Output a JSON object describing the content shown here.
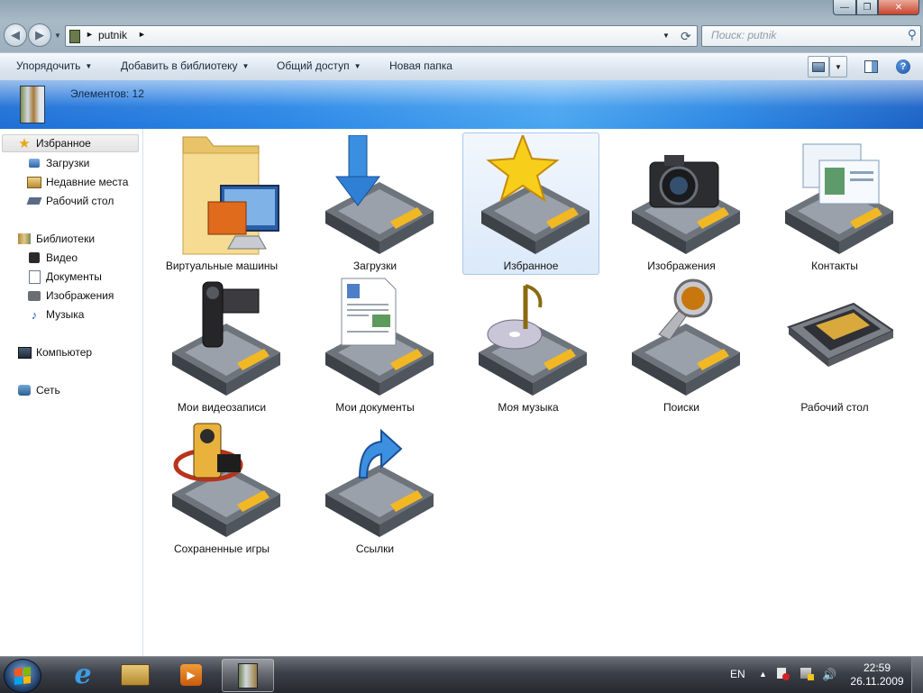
{
  "window": {
    "minimize_glyph": "—",
    "maximize_glyph": "❐",
    "close_glyph": "✕"
  },
  "address_bar": {
    "segments": [
      "putnik"
    ],
    "separator_glyph": "►",
    "dropdown_glyph": "▼"
  },
  "search": {
    "placeholder": "Поиск: putnik"
  },
  "toolbar": {
    "organize": "Упорядочить",
    "add_to_library": "Добавить в библиотеку",
    "share": "Общий доступ",
    "new_folder": "Новая папка",
    "dropdown_glyph": "▼",
    "help_glyph": "?"
  },
  "banner": {
    "item_count": "Элементов: 12"
  },
  "nav": {
    "favorites": {
      "label": "Избранное",
      "items": [
        "Загрузки",
        "Недавние места",
        "Рабочий стол"
      ]
    },
    "libraries": {
      "label": "Библиотеки",
      "items": [
        "Видео",
        "Документы",
        "Изображения",
        "Музыка"
      ]
    },
    "computer": "Компьютер",
    "network": "Сеть"
  },
  "content": {
    "items": [
      {
        "label": "Виртуальные машины",
        "icon": "virtual-machines-folder-icon"
      },
      {
        "label": "Загрузки",
        "icon": "downloads-folder-icon"
      },
      {
        "label": "Избранное",
        "icon": "favorites-folder-icon",
        "selected": true
      },
      {
        "label": "Изображения",
        "icon": "pictures-folder-icon"
      },
      {
        "label": "Контакты",
        "icon": "contacts-folder-icon"
      },
      {
        "label": "Мои видеозаписи",
        "icon": "videos-folder-icon"
      },
      {
        "label": "Мои документы",
        "icon": "documents-folder-icon"
      },
      {
        "label": "Моя музыка",
        "icon": "music-folder-icon"
      },
      {
        "label": "Поиски",
        "icon": "searches-folder-icon"
      },
      {
        "label": "Рабочий стол",
        "icon": "desktop-folder-icon"
      },
      {
        "label": "Сохраненные игры",
        "icon": "saved-games-folder-icon"
      },
      {
        "label": "Ссылки",
        "icon": "links-folder-icon"
      }
    ]
  },
  "taskbar": {
    "language": "EN",
    "tray_arrow": "▲",
    "time": "22:59",
    "date": "26.11.2009"
  },
  "colors": {
    "banner": "#2a86e6",
    "selection": "#dbe9f9",
    "taskbar": "#3b3f47"
  }
}
